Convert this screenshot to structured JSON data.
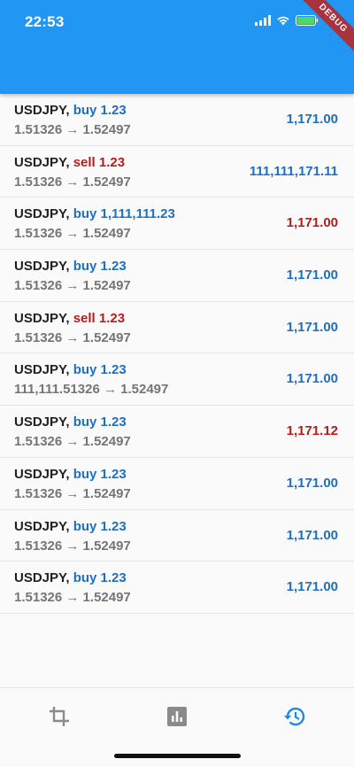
{
  "status_bar": {
    "time": "22:53"
  },
  "debug_banner": "DEBUG",
  "trades": [
    {
      "symbol": "USDJPY",
      "side": "buy",
      "qty": "1.23",
      "prices": "1.51326 → 1.52497",
      "amount": "1,171.00",
      "amount_color": "blue"
    },
    {
      "symbol": "USDJPY",
      "side": "sell",
      "qty": "1.23",
      "prices": "1.51326 → 1.52497",
      "amount": "111,111,171.11",
      "amount_color": "blue"
    },
    {
      "symbol": "USDJPY",
      "side": "buy",
      "qty": "1,111,111.23",
      "prices": "1.51326 → 1.52497",
      "amount": "1,171.00",
      "amount_color": "red"
    },
    {
      "symbol": "USDJPY",
      "side": "buy",
      "qty": "1.23",
      "prices": "1.51326 → 1.52497",
      "amount": "1,171.00",
      "amount_color": "blue"
    },
    {
      "symbol": "USDJPY",
      "side": "sell",
      "qty": "1.23",
      "prices": "1.51326 → 1.52497",
      "amount": "1,171.00",
      "amount_color": "blue"
    },
    {
      "symbol": "USDJPY",
      "side": "buy",
      "qty": "1.23",
      "prices": "111,111.51326 → 1.52497",
      "amount": "1,171.00",
      "amount_color": "blue"
    },
    {
      "symbol": "USDJPY",
      "side": "buy",
      "qty": "1.23",
      "prices": "1.51326 → 1.52497",
      "amount": "1,171.12",
      "amount_color": "red"
    },
    {
      "symbol": "USDJPY",
      "side": "buy",
      "qty": "1.23",
      "prices": "1.51326 → 1.52497",
      "amount": "1,171.00",
      "amount_color": "blue"
    },
    {
      "symbol": "USDJPY",
      "side": "buy",
      "qty": "1.23",
      "prices": "1.51326 → 1.52497",
      "amount": "1,171.00",
      "amount_color": "blue"
    },
    {
      "symbol": "USDJPY",
      "side": "buy",
      "qty": "1.23",
      "prices": "1.51326 → 1.52497",
      "amount": "1,171.00",
      "amount_color": "blue"
    }
  ],
  "bottom_nav": {
    "items": [
      {
        "icon": "crop-icon",
        "active": false
      },
      {
        "icon": "bar-chart-icon",
        "active": false
      },
      {
        "icon": "history-icon",
        "active": true
      }
    ]
  },
  "colors": {
    "app_bar": "#2196f3",
    "buy": "#1e6fc2",
    "sell": "#b71c1c",
    "nav_inactive": "#8a8a8a",
    "nav_active": "#1e88e5"
  }
}
